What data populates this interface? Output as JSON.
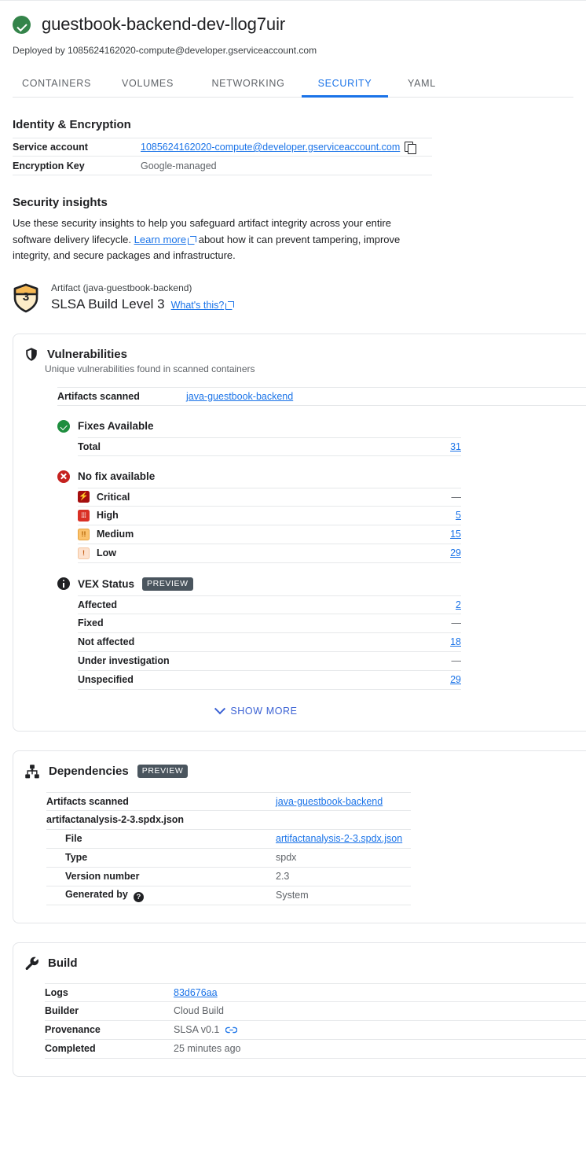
{
  "header": {
    "status_icon": "check-circle-icon",
    "title": "guestbook-backend-dev-llog7uir",
    "subtitle": "Deployed by 1085624162020-compute@developer.gserviceaccount.com",
    "accent_color": "#1a73e8",
    "status_color": "#34844a"
  },
  "tabs": [
    {
      "label": "CONTAINERS",
      "active": false
    },
    {
      "label": "VOLUMES",
      "active": false
    },
    {
      "label": "NETWORKING",
      "active": false
    },
    {
      "label": "SECURITY",
      "active": true
    },
    {
      "label": "YAML",
      "active": false
    }
  ],
  "identity": {
    "heading": "Identity & Encryption",
    "rows": [
      {
        "key": "Service account",
        "value": "1085624162020-compute@developer.gserviceaccount.com",
        "is_link": true,
        "has_copy": true
      },
      {
        "key": "Encryption Key",
        "value": "Google-managed",
        "is_link": false,
        "has_copy": false
      }
    ],
    "copy_icon": "copy-icon"
  },
  "insights": {
    "heading": "Security insights",
    "text_before": "Use these security insights to help you safeguard artifact integrity across your entire software delivery lifecycle. ",
    "link": "Learn more",
    "text_after": " about how it can prevent tampering, improve integrity, and secure packages and infrastructure."
  },
  "slsa": {
    "badge_icon": "slsa-shield-level-3-icon",
    "badge_level": "3",
    "artifact_line": "Artifact (java-guestbook-backend)",
    "level_text": "SLSA Build Level 3",
    "whats_this": "What's this?"
  },
  "vulnerabilities": {
    "icon": "shield-icon",
    "title": "Vulnerabilities",
    "subtitle": "Unique vulnerabilities found in scanned containers",
    "artifacts_scanned_label": "Artifacts scanned",
    "artifacts_scanned_value": "java-guestbook-backend",
    "groups": [
      {
        "icon": "check-circle-icon",
        "title": "Fixes Available",
        "rows": [
          {
            "label": "Total",
            "value": "31",
            "is_link": true,
            "severity": null
          }
        ]
      },
      {
        "icon": "error-circle-icon",
        "title": "No fix available",
        "rows": [
          {
            "label": "Critical",
            "value": "—",
            "is_link": false,
            "severity": "critical"
          },
          {
            "label": "High",
            "value": "5",
            "is_link": true,
            "severity": "high"
          },
          {
            "label": "Medium",
            "value": "15",
            "is_link": true,
            "severity": "medium"
          },
          {
            "label": "Low",
            "value": "29",
            "is_link": true,
            "severity": "low"
          }
        ]
      },
      {
        "icon": "info-circle-icon",
        "title": "VEX Status",
        "badge": "PREVIEW",
        "rows": [
          {
            "label": "Affected",
            "value": "2",
            "is_link": true,
            "severity": null
          },
          {
            "label": "Fixed",
            "value": "—",
            "is_link": false,
            "severity": null
          },
          {
            "label": "Not affected",
            "value": "18",
            "is_link": true,
            "severity": null
          },
          {
            "label": "Under investigation",
            "value": "—",
            "is_link": false,
            "severity": null
          },
          {
            "label": "Unspecified",
            "value": "29",
            "is_link": true,
            "severity": null
          }
        ]
      }
    ],
    "show_more": "SHOW MORE"
  },
  "dependencies": {
    "icon": "account-tree-icon",
    "title": "Dependencies",
    "badge": "PREVIEW",
    "rows": [
      {
        "key": "Artifacts scanned",
        "value": "java-guestbook-backend",
        "is_link": true,
        "indent": false,
        "help": false
      },
      {
        "key": "artifactanalysis-2-3.spdx.json",
        "value": "",
        "is_link": false,
        "indent": false,
        "help": false
      },
      {
        "key": "File",
        "value": "artifactanalysis-2-3.spdx.json",
        "is_link": true,
        "indent": true,
        "help": false
      },
      {
        "key": "Type",
        "value": "spdx",
        "is_link": false,
        "indent": true,
        "help": false
      },
      {
        "key": "Version number",
        "value": "2.3",
        "is_link": false,
        "indent": true,
        "help": false
      },
      {
        "key": "Generated by",
        "value": "System",
        "is_link": false,
        "indent": true,
        "help": true
      }
    ]
  },
  "build": {
    "icon": "wrench-icon",
    "title": "Build",
    "rows": [
      {
        "key": "Logs",
        "value": "83d676aa",
        "is_link": true,
        "has_link_icon": false
      },
      {
        "key": "Builder",
        "value": "Cloud Build",
        "is_link": false,
        "has_link_icon": false
      },
      {
        "key": "Provenance",
        "value": "SLSA v0.1",
        "is_link": false,
        "has_link_icon": true
      },
      {
        "key": "Completed",
        "value": "25 minutes ago",
        "is_link": false,
        "has_link_icon": false
      }
    ]
  }
}
